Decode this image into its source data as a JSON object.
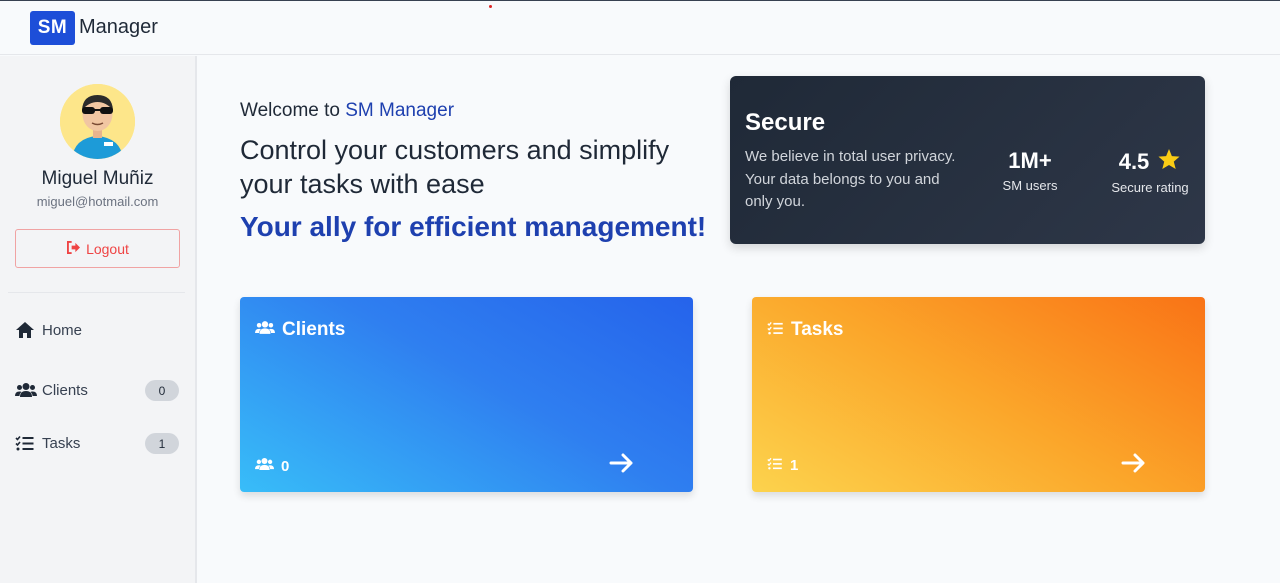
{
  "app": {
    "logo": "SM",
    "name": "Manager"
  },
  "user": {
    "name": "Miguel Muñiz",
    "email": "miguel@hotmail.com",
    "logout_label": "Logout"
  },
  "nav": {
    "home": {
      "label": "Home"
    },
    "clients": {
      "label": "Clients",
      "count": "0"
    },
    "tasks": {
      "label": "Tasks",
      "count": "1"
    }
  },
  "hero": {
    "welcome_prefix": "Welcome to ",
    "welcome_brand": "SM Manager",
    "headline": "Control your customers and simplify your tasks with ease",
    "tagline": "Your ally for efficient management!"
  },
  "secure": {
    "title": "Secure",
    "description": "We believe in total user privacy. Your data belongs to you and only you.",
    "stats": [
      {
        "value": "1M+",
        "label": "SM users"
      },
      {
        "value": "4.5",
        "label": "Secure rating"
      }
    ]
  },
  "cards": {
    "clients": {
      "title": "Clients",
      "count": "0"
    },
    "tasks": {
      "title": "Tasks",
      "count": "1"
    }
  },
  "colors": {
    "primary": "#1d4ed8",
    "brand_text": "#1e40af",
    "dark_card": "#1f2937",
    "clients_gradient": [
      "#38bdf8",
      "#2563eb"
    ],
    "tasks_gradient": [
      "#fcd34d",
      "#f97316"
    ],
    "logout": "#ef4444",
    "star": "#facc15"
  },
  "icons": {
    "logout": "sign-out-icon",
    "home": "home-icon",
    "clients": "users-icon",
    "tasks": "tasks-list-icon",
    "rating": "star-icon",
    "card_link": "arrow-right-icon"
  }
}
